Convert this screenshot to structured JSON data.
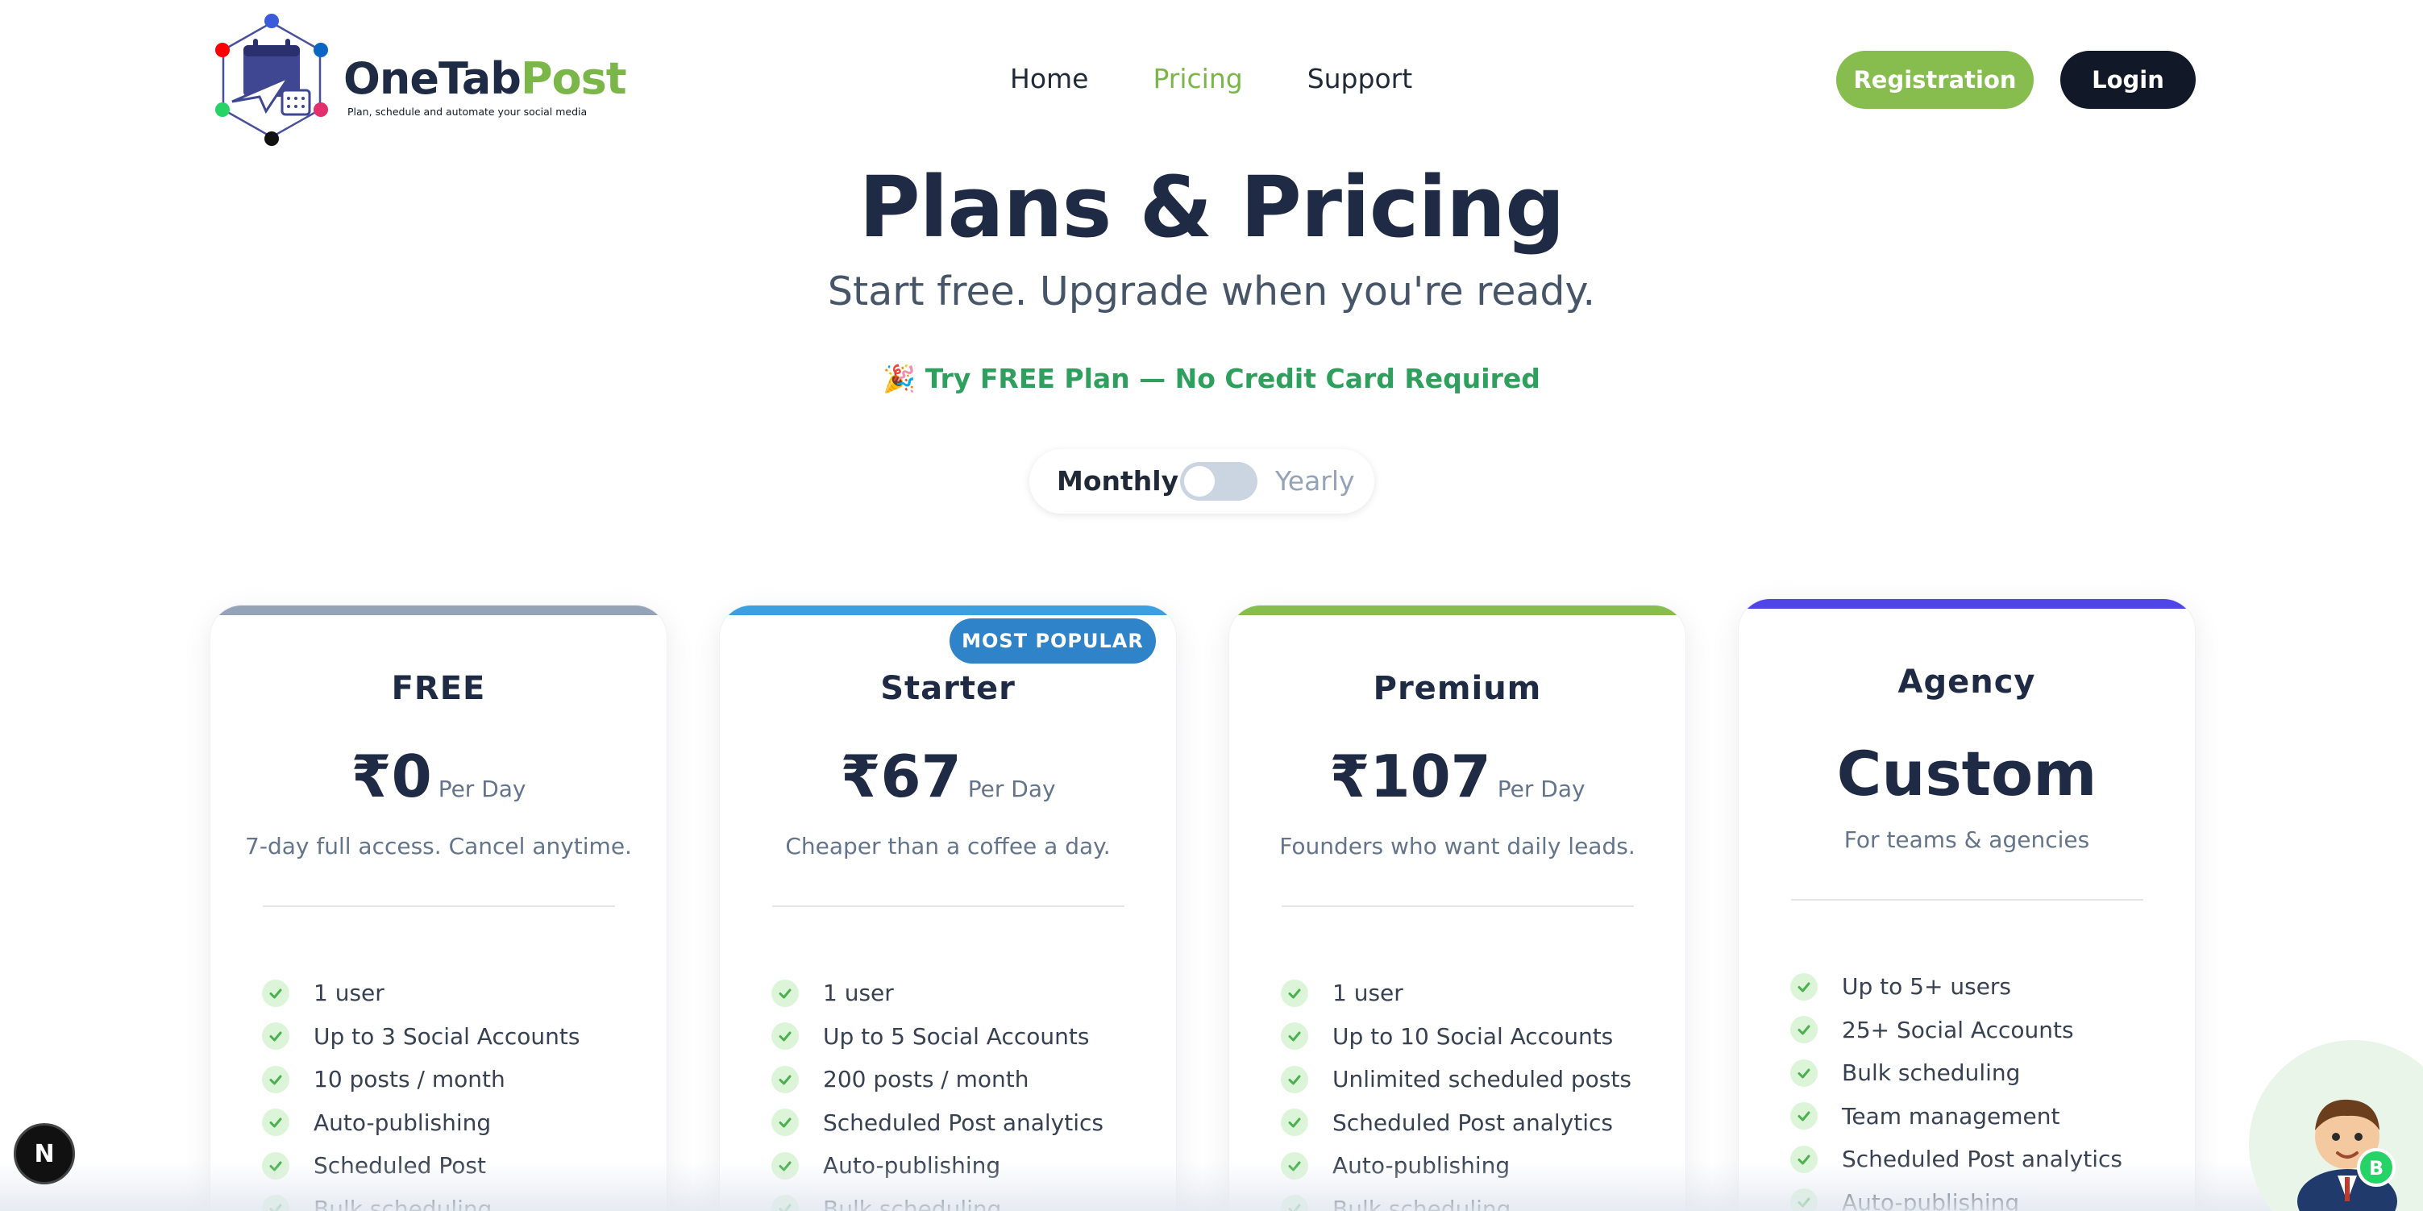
{
  "brand": {
    "name_part1": "OneTab",
    "name_part2": "Post",
    "tagline": "Plan, schedule and automate your social media",
    "accent": "#7ab648",
    "dark": "#1f2a44"
  },
  "nav": {
    "items": [
      {
        "label": "Home",
        "active": false
      },
      {
        "label": "Pricing",
        "active": true
      },
      {
        "label": "Support",
        "active": false
      }
    ]
  },
  "auth": {
    "register_label": "Registration",
    "login_label": "Login"
  },
  "hero": {
    "title": "Plans & Pricing",
    "subtitle": "Start free. Upgrade when you're ready.",
    "free_note": "🎉 Try FREE Plan — No Credit Card Required"
  },
  "billing_toggle": {
    "monthly_label": "Monthly",
    "yearly_label": "Yearly",
    "selected": "Monthly"
  },
  "plans": [
    {
      "name": "FREE",
      "price": "₹0",
      "period": "Per Day",
      "description": "7-day full access. Cancel anytime.",
      "bar_color": "#94a3b8",
      "features": [
        "1 user",
        "Up to 3 Social Accounts",
        "10 posts / month",
        "Auto-publishing",
        "Scheduled Post",
        "Bulk scheduling"
      ]
    },
    {
      "name": "Starter",
      "price": "₹67",
      "period": "Per Day",
      "description": "Cheaper than a coffee a day.",
      "badge": "MOST POPULAR",
      "bar_color": "#3b9fe0",
      "features": [
        "1 user",
        "Up to 5 Social Accounts",
        "200 posts / month",
        "Scheduled Post analytics",
        "Auto-publishing",
        "Bulk scheduling"
      ]
    },
    {
      "name": "Premium",
      "price": "₹107",
      "period": "Per Day",
      "description": "Founders who want daily leads.",
      "bar_color": "#86bd4e",
      "features": [
        "1 user",
        "Up to 10 Social Accounts",
        "Unlimited scheduled posts",
        "Scheduled Post analytics",
        "Auto-publishing",
        "Bulk scheduling"
      ]
    },
    {
      "name": "Agency",
      "price": "Custom",
      "description": "For teams & agencies",
      "bar_color": "#4f46e5",
      "features": [
        "Up to 5+ users",
        "25+ Social Accounts",
        "Bulk scheduling",
        "Team management",
        "Scheduled Post analytics",
        "Auto-publishing"
      ]
    }
  ],
  "dev_badge": "N"
}
